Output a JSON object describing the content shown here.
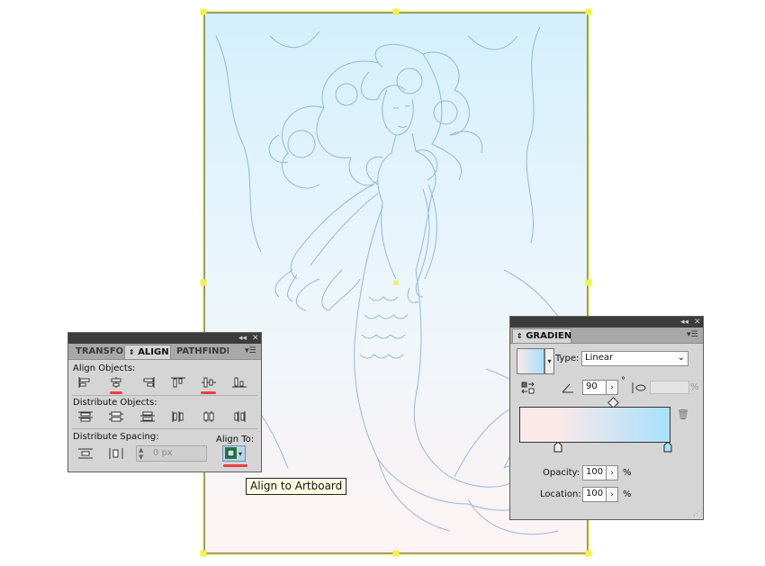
{
  "align_panel": {
    "tabs": [
      "TRANSFOR",
      "ALIGN",
      "PATHFINDE"
    ],
    "active_tab": "ALIGN",
    "align_objects_label": "Align Objects:",
    "distribute_objects_label": "Distribute Objects:",
    "distribute_spacing_label": "Distribute Spacing:",
    "align_to_label": "Align To:",
    "spacing_value": "0 px",
    "tooltip": "Align to Artboard",
    "align_objects_icons": [
      "horizontal-align-left-icon",
      "horizontal-align-center-icon",
      "horizontal-align-right-icon",
      "vertical-align-top-icon",
      "vertical-align-center-icon",
      "vertical-align-bottom-icon"
    ],
    "distribute_objects_icons": [
      "vertical-distribute-top-icon",
      "vertical-distribute-center-icon",
      "vertical-distribute-bottom-icon",
      "horizontal-distribute-left-icon",
      "horizontal-distribute-center-icon",
      "horizontal-distribute-right-icon"
    ],
    "distribute_spacing_icons": [
      "vertical-distribute-space-icon",
      "horizontal-distribute-space-icon"
    ],
    "highlight_color": "#ef3f46"
  },
  "gradient_panel": {
    "title": "GRADIENT",
    "type_label": "Type:",
    "type_value": "Linear",
    "angle_value": "90",
    "angle_unit": "°",
    "aspect_unit": "%",
    "opacity_label": "Opacity:",
    "opacity_value": "100",
    "opacity_unit": "%",
    "location_label": "Location:",
    "location_value": "100",
    "location_unit": "%",
    "start_color": "#fbe9ea",
    "end_color": "#a8e1fb"
  },
  "artboard": {
    "border_color": "#1a1a1a",
    "selection_color": "#f2f24a",
    "top_color": "#d3f0fd",
    "bottom_color": "#fdf3f3",
    "sketch_color": "#6f9bd0"
  }
}
